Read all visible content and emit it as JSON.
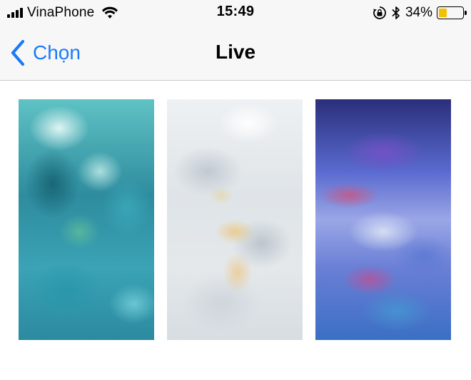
{
  "status_bar": {
    "carrier": "VinaPhone",
    "time": "15:49",
    "battery_percent": "34%",
    "battery_level": 0.34,
    "battery_color": "#f2c100",
    "icons": [
      "signal-icon",
      "wifi-icon",
      "rotation-lock-icon",
      "bluetooth-icon",
      "battery-icon"
    ]
  },
  "nav": {
    "back_label": "Chọn",
    "title": "Live",
    "accent": "#1a7cf5"
  },
  "wallpapers": [
    {
      "theme": "teal"
    },
    {
      "theme": "white"
    },
    {
      "theme": "purple"
    }
  ]
}
